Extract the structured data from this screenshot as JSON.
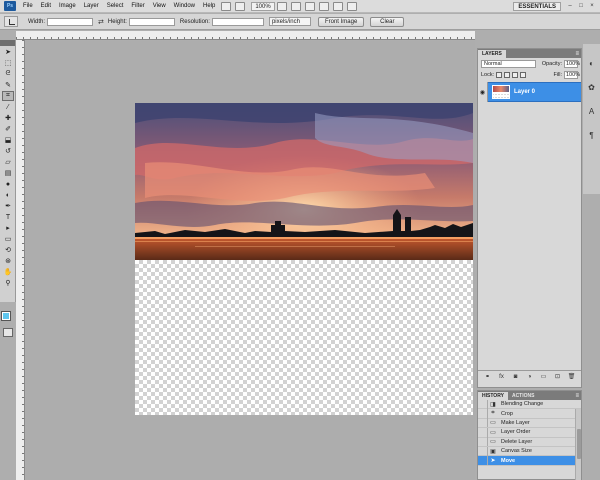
{
  "menu": {
    "logo": "Ps",
    "items": [
      "File",
      "Edit",
      "Image",
      "Layer",
      "Select",
      "Filter",
      "View",
      "Window",
      "Help"
    ],
    "zoom": "100%",
    "workspace": "ESSENTIALS"
  },
  "options": {
    "width_label": "Width:",
    "width_value": "",
    "height_label": "Height:",
    "height_value": "",
    "resolution_label": "Resolution:",
    "resolution_value": "",
    "resolution_unit": "pixels/inch",
    "front_image_label": "Front Image",
    "clear_label": "Clear"
  },
  "tools": [
    "move",
    "marquee",
    "lasso",
    "quick-select",
    "crop",
    "eyedropper",
    "healing",
    "brush",
    "clone-stamp",
    "history-brush",
    "eraser",
    "gradient",
    "blur",
    "dodge",
    "pen",
    "type",
    "path-select",
    "shape",
    "3d-rotate",
    "3d-orbit",
    "hand",
    "zoom"
  ],
  "colors": {
    "foreground": "#5ec6ee",
    "selection": "#3d8fe6"
  },
  "layers_panel": {
    "tab": "LAYERS",
    "blend_mode": "Normal",
    "opacity_label": "Opacity:",
    "opacity_value": "100%",
    "lock_label": "Lock:",
    "fill_label": "Fill:",
    "fill_value": "100%",
    "layers": [
      {
        "name": "Layer 0",
        "selected": true,
        "visible": true
      }
    ]
  },
  "history_panel": {
    "tabs": [
      "HISTORY",
      "ACTIONS"
    ],
    "items": [
      {
        "label": "Blending Change",
        "icon": "blend-icon"
      },
      {
        "label": "Crop",
        "icon": "crop-icon"
      },
      {
        "label": "Make Layer",
        "icon": "layer-icon"
      },
      {
        "label": "Layer Order",
        "icon": "layer-order-icon"
      },
      {
        "label": "Delete Layer",
        "icon": "delete-icon"
      },
      {
        "label": "Canvas Size",
        "icon": "canvas-icon"
      },
      {
        "label": "Move",
        "icon": "move-icon",
        "active": true
      }
    ]
  }
}
